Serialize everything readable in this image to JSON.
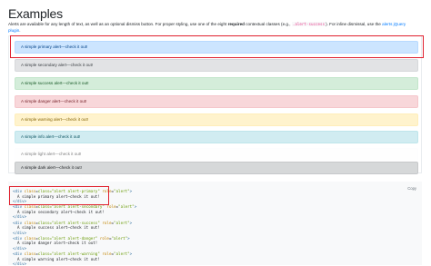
{
  "page": {
    "title": "Examples",
    "intro_part1": "Alerts are available for any length of text, as well as an optional dismiss button. For proper styling, use one of the eight ",
    "intro_bold": "required",
    "intro_part2": " contextual classes (e.g., ",
    "intro_code": ".alert-success",
    "intro_part3": "). For inline dismissal, use the ",
    "intro_link": "alerts jQuery plugin",
    "intro_part4": "."
  },
  "alerts": [
    {
      "text": "A simple primary alert—check it out!",
      "bg": "#cce5ff",
      "border": "#b8daff",
      "color": "#004085"
    },
    {
      "text": "A simple secondary alert—check it out!",
      "bg": "#e2e3e5",
      "border": "#d6d8db",
      "color": "#383d41"
    },
    {
      "text": "A simple success alert—check it out!",
      "bg": "#d4edda",
      "border": "#c3e6cb",
      "color": "#155724"
    },
    {
      "text": "A simple danger alert—check it out!",
      "bg": "#f8d7da",
      "border": "#f5c6cb",
      "color": "#721c24"
    },
    {
      "text": "A simple warning alert—check it out!",
      "bg": "#fff3cd",
      "border": "#ffeeba",
      "color": "#856404"
    },
    {
      "text": "A simple info alert—check it out!",
      "bg": "#d1ecf1",
      "border": "#bee5eb",
      "color": "#0c5460"
    },
    {
      "text": "A simple light alert—check it out!",
      "bg": "#fefefe",
      "border": "#fdfdfe",
      "color": "#818182"
    },
    {
      "text": "A simple dark alert—check it out!",
      "bg": "#d6d8d9",
      "border": "#c6c8ca",
      "color": "#1b1e21"
    }
  ],
  "code": {
    "copy_label": "Copy",
    "blocks": [
      {
        "variant": "alert-primary",
        "text": "A simple primary alert—check it out!"
      },
      {
        "variant": "alert-secondary",
        "text": "A simple secondary alert—check it out!"
      },
      {
        "variant": "alert-success",
        "text": "A simple success alert—check it out!"
      },
      {
        "variant": "alert-danger",
        "text": "A simple danger alert—check it out!"
      },
      {
        "variant": "alert-warning",
        "text": "A simple warning alert—check it out!"
      }
    ]
  },
  "colors": {
    "highlight": "#e0202d",
    "link": "#007bff",
    "code_bg": "#f8f9fa"
  }
}
